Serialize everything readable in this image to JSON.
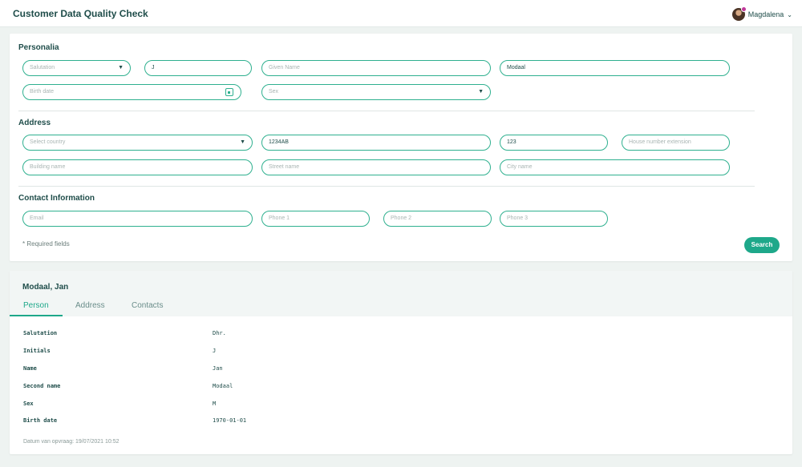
{
  "header": {
    "app_title": "Customer Data Quality Check",
    "user_name": "Magdalena",
    "user_chevron": "⌄"
  },
  "search": {
    "personalia_title": "Personalia",
    "salutation_placeholder": "Salutation",
    "initials_value": "J",
    "given_name_placeholder": "Given Name",
    "surname_value": "Modaal",
    "birth_date_placeholder": "Birth date",
    "sex_placeholder": "Sex",
    "address_title": "Address",
    "country_placeholder": "Select country",
    "postcode_value": "1234AB",
    "house_number_value": "123",
    "house_number_extension_placeholder": "House number extension",
    "building_name_placeholder": "Building name",
    "street_name_placeholder": "Street name",
    "city_name_placeholder": "City name",
    "contact_title": "Contact Information",
    "email_placeholder": "Email",
    "phone1_placeholder": "Phone 1",
    "phone2_placeholder": "Phone 2",
    "phone3_placeholder": "Phone 3",
    "required_note": "* Required fields",
    "search_button": "Search"
  },
  "result": {
    "name": "Modaal, Jan",
    "tabs": [
      {
        "label": "Person"
      },
      {
        "label": "Address"
      },
      {
        "label": "Contacts"
      }
    ],
    "details": [
      {
        "label": "Salutation",
        "value": "Dhr."
      },
      {
        "label": "Initials",
        "value": "J"
      },
      {
        "label": "Name",
        "value": "Jan"
      },
      {
        "label": "Second name",
        "value": "Modaal"
      },
      {
        "label": "Sex",
        "value": "M"
      },
      {
        "label": "Birth date",
        "value": "1970-01-01"
      }
    ],
    "timestamp": "Datum van opvraag: 19/07/2021 10:52"
  },
  "colors": {
    "accent": "#1ea88a",
    "text": "#1f4d4a",
    "background": "#eef3f1"
  }
}
